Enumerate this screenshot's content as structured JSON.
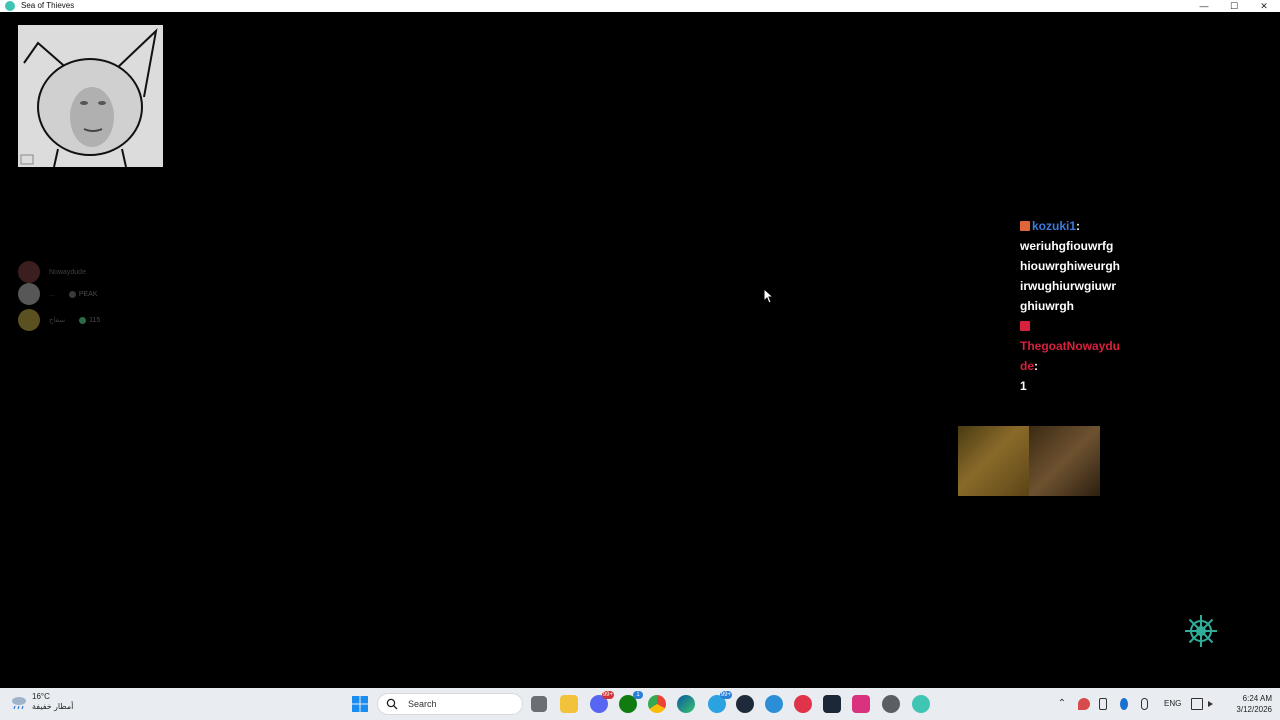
{
  "window": {
    "title": "Sea of Thieves"
  },
  "voice": {
    "members": [
      {
        "name": "Nowaydude",
        "game": ""
      },
      {
        "name": "...",
        "game": "PEAK"
      },
      {
        "name": "سفاح",
        "game": "115"
      }
    ]
  },
  "chat": {
    "messages": [
      {
        "user": "kozuki1",
        "badge_color": "#e0663a",
        "lines": [
          "weriuhgfiouwrfg",
          "hiouwrghiweurgh",
          "irwughiurwgiuwr",
          "ghiuwrgh"
        ]
      },
      {
        "user_line1": "ThegoatNowaydu",
        "user_line2": "de",
        "badge_color": "#d6213f",
        "lines": [
          "1"
        ]
      }
    ],
    "colon": ":"
  },
  "taskbar": {
    "weather_temp": "16°C",
    "weather_desc": "أمطار خفيفة",
    "search_label": "Search",
    "badges": {
      "discord": "99+",
      "xbox": "1",
      "telegram": "99+"
    },
    "language": "ENG",
    "time": "6:24 AM",
    "date": "3/12/2026"
  },
  "icons": {
    "accent_teal": "#3fc5b3",
    "windows_blue": "#1a8cf0"
  }
}
